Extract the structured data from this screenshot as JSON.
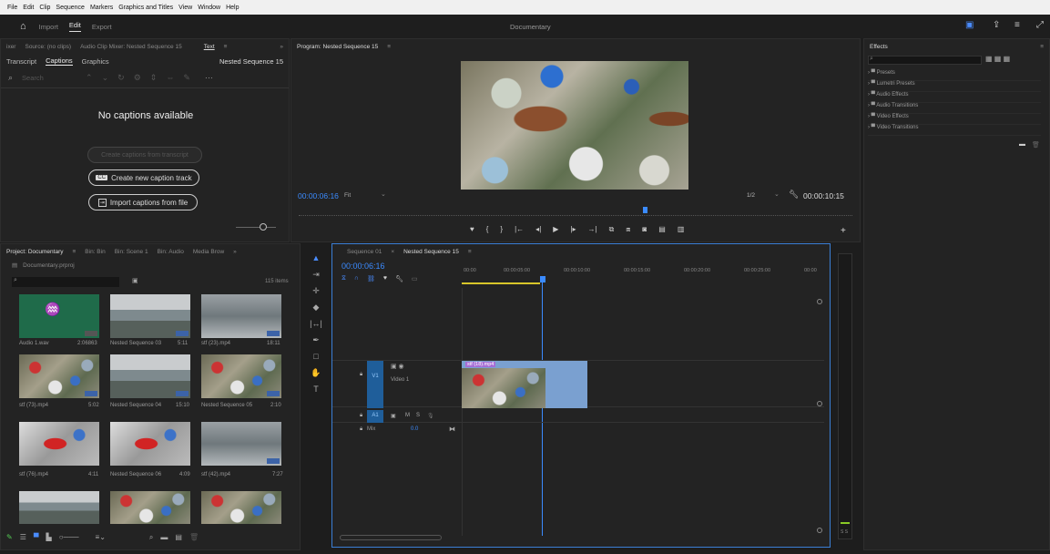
{
  "menubar": {
    "items": [
      "File",
      "Edit",
      "Clip",
      "Sequence",
      "Markers",
      "Graphics and Titles",
      "View",
      "Window",
      "Help"
    ]
  },
  "topbar": {
    "tabs": [
      "Import",
      "Edit",
      "Export"
    ],
    "active": "Edit",
    "title": "Documentary"
  },
  "caption_panel": {
    "header_tabs": [
      "ixer",
      "Source: (no clips)",
      "Audio Clip Mixer: Nested Sequence 15",
      "Text"
    ],
    "sub_tabs": [
      "Transcript",
      "Captions",
      "Graphics"
    ],
    "sequence": "Nested Sequence 15",
    "search_placeholder": "Search",
    "empty_message": "No captions available",
    "create_from_transcript": "Create captions from transcript",
    "create_new_track": "Create new caption track",
    "import_file": "Import captions from file"
  },
  "program": {
    "title": "Program: Nested Sequence 15",
    "timecode": "00:00:06:16",
    "fit": "Fit",
    "resolution": "1/2",
    "duration": "00:00:10:15"
  },
  "effects": {
    "title": "Effects",
    "items": [
      "Presets",
      "Lumetri Presets",
      "Audio Effects",
      "Audio Transitions",
      "Video Effects",
      "Video Transitions"
    ]
  },
  "project": {
    "tabs": [
      "Project: Documentary",
      "Bin: Bin",
      "Bin: Scene 1",
      "Bin: Audio",
      "Media Brow"
    ],
    "file": "Documentary.prproj",
    "count": "115 items",
    "items": [
      {
        "name": "Audio 1.wav",
        "dur": "2:06863"
      },
      {
        "name": "Nested Sequence 03",
        "dur": "5:11"
      },
      {
        "name": "stf (23).mp4",
        "dur": "18:11"
      },
      {
        "name": "stf (73).mp4",
        "dur": "5:02"
      },
      {
        "name": "Nested Sequence 04",
        "dur": "15:10"
      },
      {
        "name": "Nested Sequence 05",
        "dur": "2:10"
      },
      {
        "name": "stf (76).mp4",
        "dur": "4:11"
      },
      {
        "name": "Nested Sequence 06",
        "dur": "4:09"
      },
      {
        "name": "stf (42).mp4",
        "dur": "7:27"
      }
    ]
  },
  "timeline": {
    "tabs": [
      "Sequence 01",
      "Nested Sequence 15"
    ],
    "timecode": "00:00:06:16",
    "ruler": [
      "00:00",
      "00:00:05:00",
      "00:00:10:00",
      "00:00:15:00",
      "00:00:20:00",
      "00:00:25:00",
      "00:00"
    ],
    "video_track": "Video 1",
    "v1": "V1",
    "a1": "A1",
    "mix": "Mix",
    "mix_val": "0.0",
    "clip": "stf (18).mp4",
    "m": "M",
    "s": "S"
  },
  "meter": {
    "label": "S S"
  }
}
